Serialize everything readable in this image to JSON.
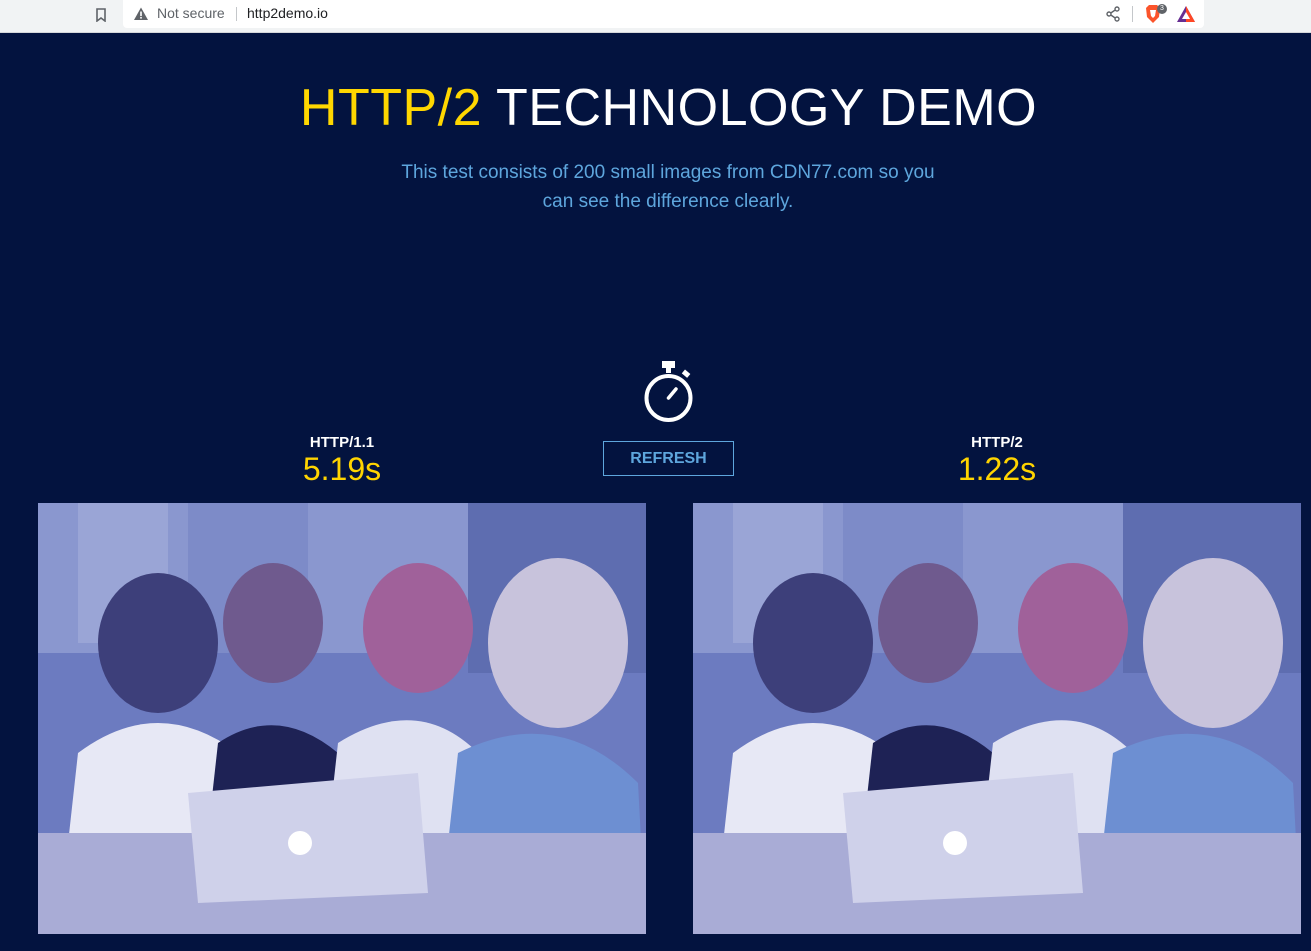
{
  "browser": {
    "security_label": "Not secure",
    "url": "http2demo.io",
    "shields_count": "3",
    "icons": [
      "bookmark-icon",
      "warning-icon",
      "share-icon",
      "brave-shields-icon",
      "brave-rewards-icon"
    ]
  },
  "header": {
    "title_accent": "HTTP/2",
    "title_rest": " TECHNOLOGY DEMO",
    "subtitle": "This test consists of 200 small images from CDN77.com so you can see the difference clearly."
  },
  "comparison": {
    "left": {
      "label": "HTTP/1.1",
      "time": "5.19s"
    },
    "right": {
      "label": "HTTP/2",
      "time": "1.22s"
    },
    "refresh_label": "REFRESH",
    "timer_icon": "stopwatch-icon"
  },
  "colors": {
    "background": "#03133f",
    "accent_yellow": "#ffd700",
    "accent_blue": "#5ea6dd",
    "photo_tint": "#6f7fc3"
  }
}
